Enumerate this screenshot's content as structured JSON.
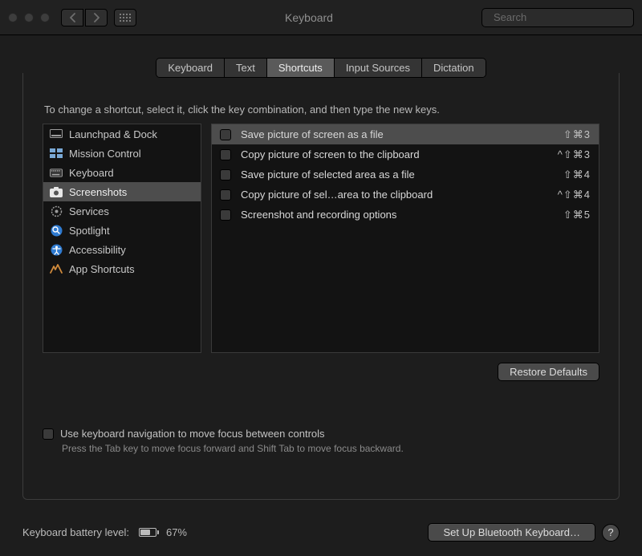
{
  "window": {
    "title": "Keyboard"
  },
  "search": {
    "placeholder": "Search"
  },
  "tabs": {
    "items": [
      {
        "label": "Keyboard"
      },
      {
        "label": "Text"
      },
      {
        "label": "Shortcuts"
      },
      {
        "label": "Input Sources"
      },
      {
        "label": "Dictation"
      }
    ],
    "active_index": 2
  },
  "instruction": "To change a shortcut, select it, click the key combination, and then type the new keys.",
  "categories": {
    "selected_index": 3,
    "items": [
      {
        "icon": "launchpad-icon",
        "label": "Launchpad & Dock"
      },
      {
        "icon": "mission-control-icon",
        "label": "Mission Control"
      },
      {
        "icon": "keyboard-icon",
        "label": "Keyboard"
      },
      {
        "icon": "screenshot-icon",
        "label": "Screenshots"
      },
      {
        "icon": "gear-icon",
        "label": "Services"
      },
      {
        "icon": "spotlight-icon",
        "label": "Spotlight"
      },
      {
        "icon": "accessibility-icon",
        "label": "Accessibility"
      },
      {
        "icon": "app-shortcuts-icon",
        "label": "App Shortcuts"
      }
    ]
  },
  "shortcuts": {
    "selected_index": 0,
    "items": [
      {
        "label": "Save picture of screen as a file",
        "keys": "⇧⌘3"
      },
      {
        "label": "Copy picture of screen to the clipboard",
        "keys": "^⇧⌘3"
      },
      {
        "label": "Save picture of selected area as a file",
        "keys": "⇧⌘4"
      },
      {
        "label": "Copy picture of sel…area to the clipboard",
        "keys": "^⇧⌘4"
      },
      {
        "label": "Screenshot and recording options",
        "keys": "⇧⌘5"
      }
    ]
  },
  "restore_label": "Restore Defaults",
  "nav": {
    "checkbox_label": "Use keyboard navigation to move focus between controls",
    "hint": "Press the Tab key to move focus forward and Shift Tab to move focus backward."
  },
  "battery": {
    "label": "Keyboard battery level:",
    "percent_text": "67%",
    "percent_value": 67
  },
  "setup_btn": "Set Up Bluetooth Keyboard…",
  "help_label": "?"
}
